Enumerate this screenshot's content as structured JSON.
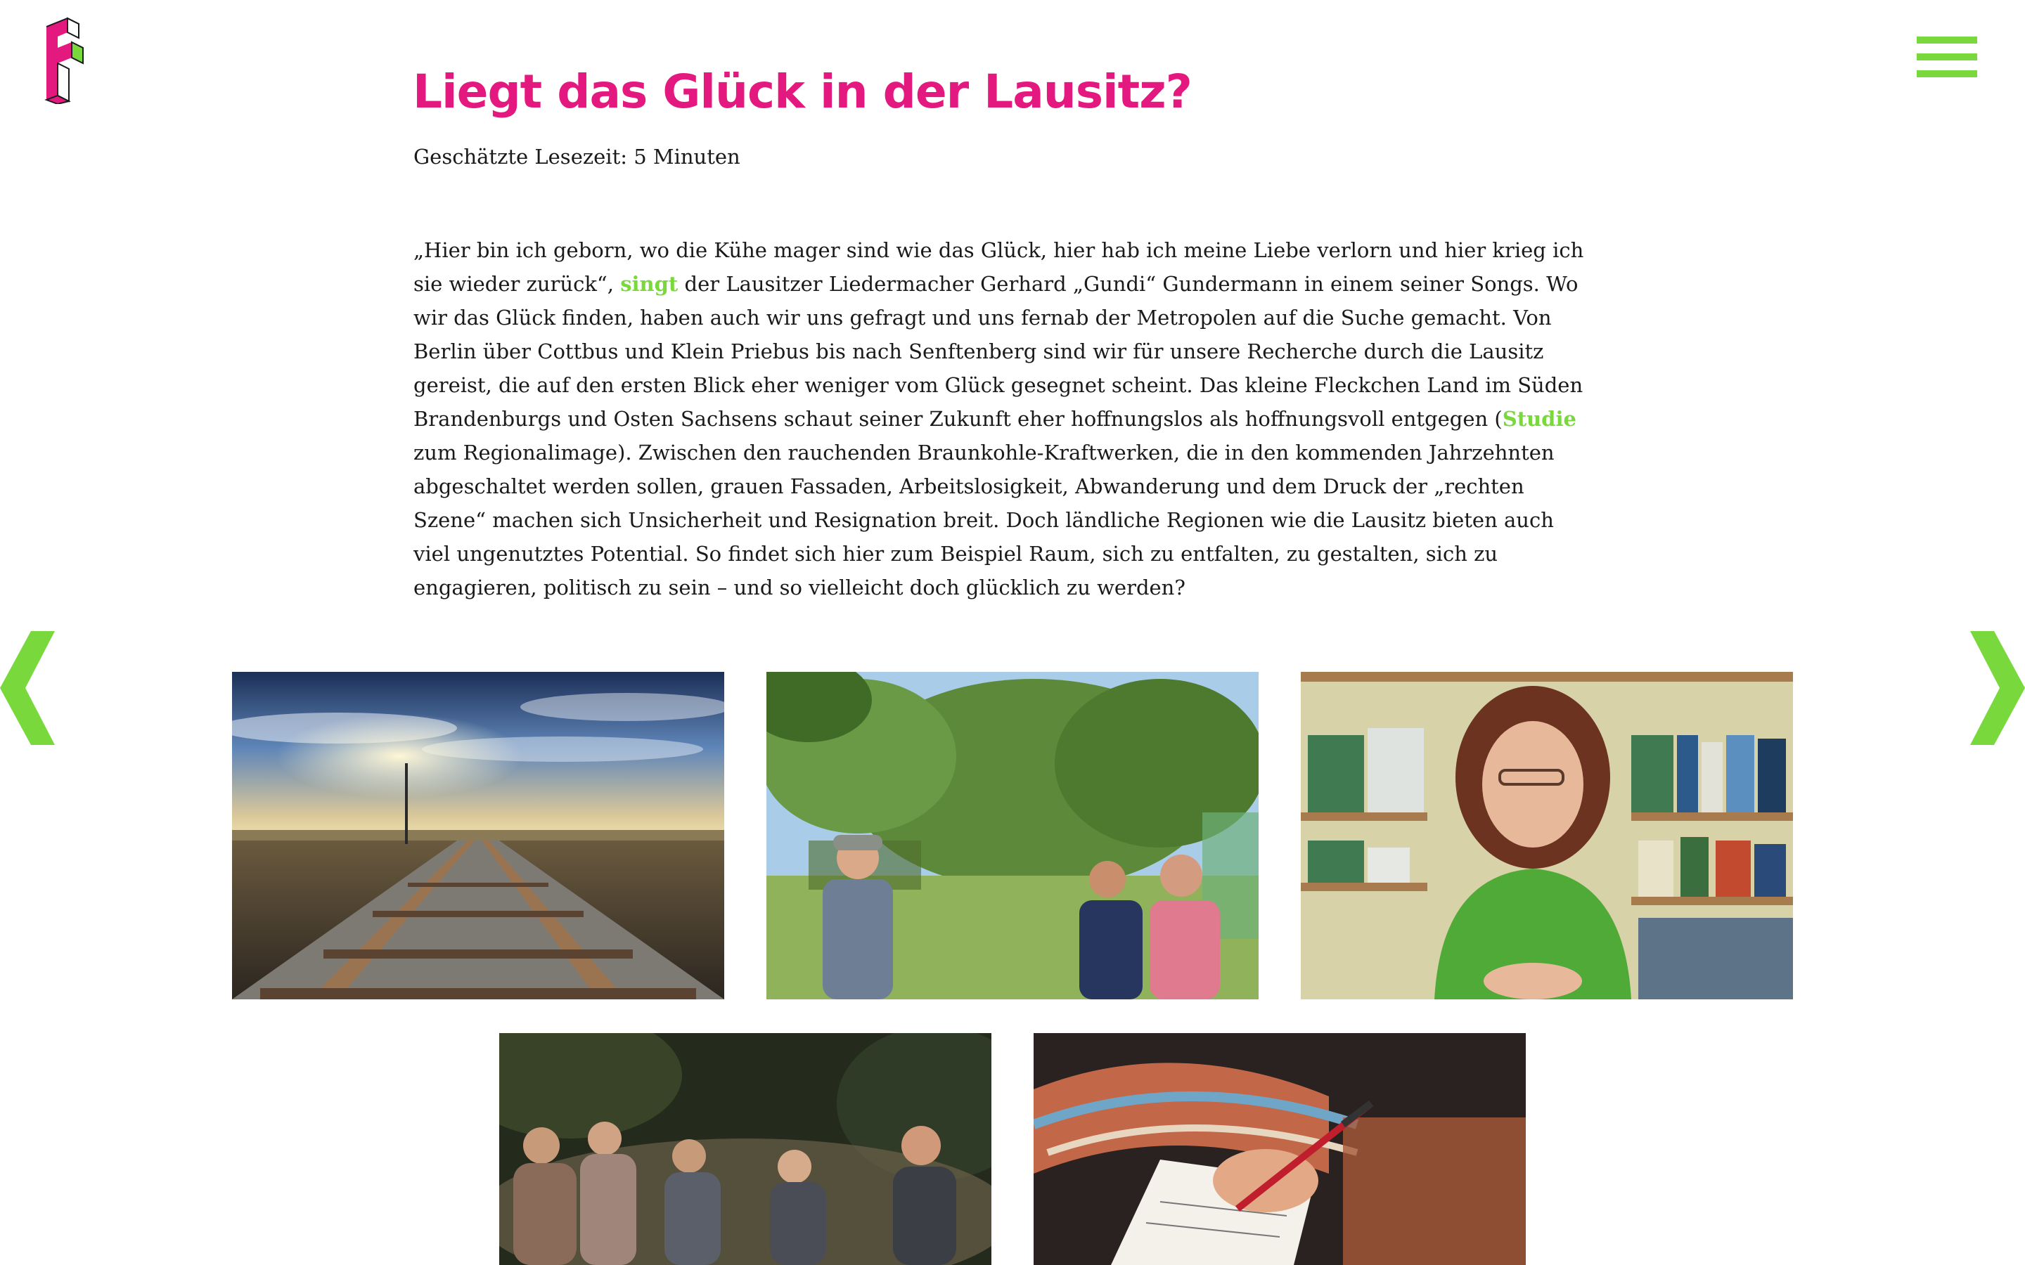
{
  "header": {
    "logo_name": "site-logo",
    "menu_icon": "hamburger-menu-icon"
  },
  "colors": {
    "accent_pink": "#e3197f",
    "accent_green": "#79d93c",
    "text": "#1a1a1a"
  },
  "article": {
    "title": "Liegt das Glück in der Lausitz?",
    "reading_time": "Geschätzte Lesezeit: 5 Minuten",
    "paragraph": {
      "part1": "„Hier bin ich geborn, wo die Kühe mager sind wie das Glück, hier hab ich meine Liebe verlorn und hier krieg ich sie wieder zurück“, ",
      "link1": "singt",
      "part2": " der Lausitzer Liedermacher Gerhard „Gundi“ Gundermann in einem seiner Songs. Wo wir das Glück finden, haben auch wir uns gefragt und uns fernab der Metropolen auf die Suche gemacht. Von Berlin über Cottbus und Klein Priebus bis nach Senftenberg sind wir für unsere Recherche durch die Lausitz gereist, die auf den ersten Blick eher weniger vom Glück gesegnet scheint. Das kleine Fleckchen Land im Süden Brandenburgs und Osten Sachsens schaut seiner Zukunft eher hoffnungslos als hoffnungsvoll entgegen (",
      "link2": "Studie",
      "part3": " zum Regionalimage). Zwischen den rauchenden Braunkohle-Kraftwerken, die in den kommenden Jahrzehnten abgeschaltet werden sollen, grauen Fassaden, Arbeitslosigkeit, Abwanderung und dem Druck der „rechten Szene“ machen sich Unsicherheit und Resignation breit. Doch ländliche Regionen wie die Lausitz bieten auch viel ungenutztes Potential. So findet sich hier zum Beispiel Raum, sich zu entfalten, zu gestalten, sich zu engagieren, politisch zu sein – und so vielleicht doch glücklich zu werden?"
    }
  },
  "gallery": {
    "prev_icon": "chevron-left-icon",
    "next_icon": "chevron-right-icon",
    "photos": [
      "railway-tracks-photo",
      "garden-conversation-photo",
      "woman-bookshelf-photo",
      "group-yoga-photo",
      "writing-hand-photo"
    ]
  }
}
